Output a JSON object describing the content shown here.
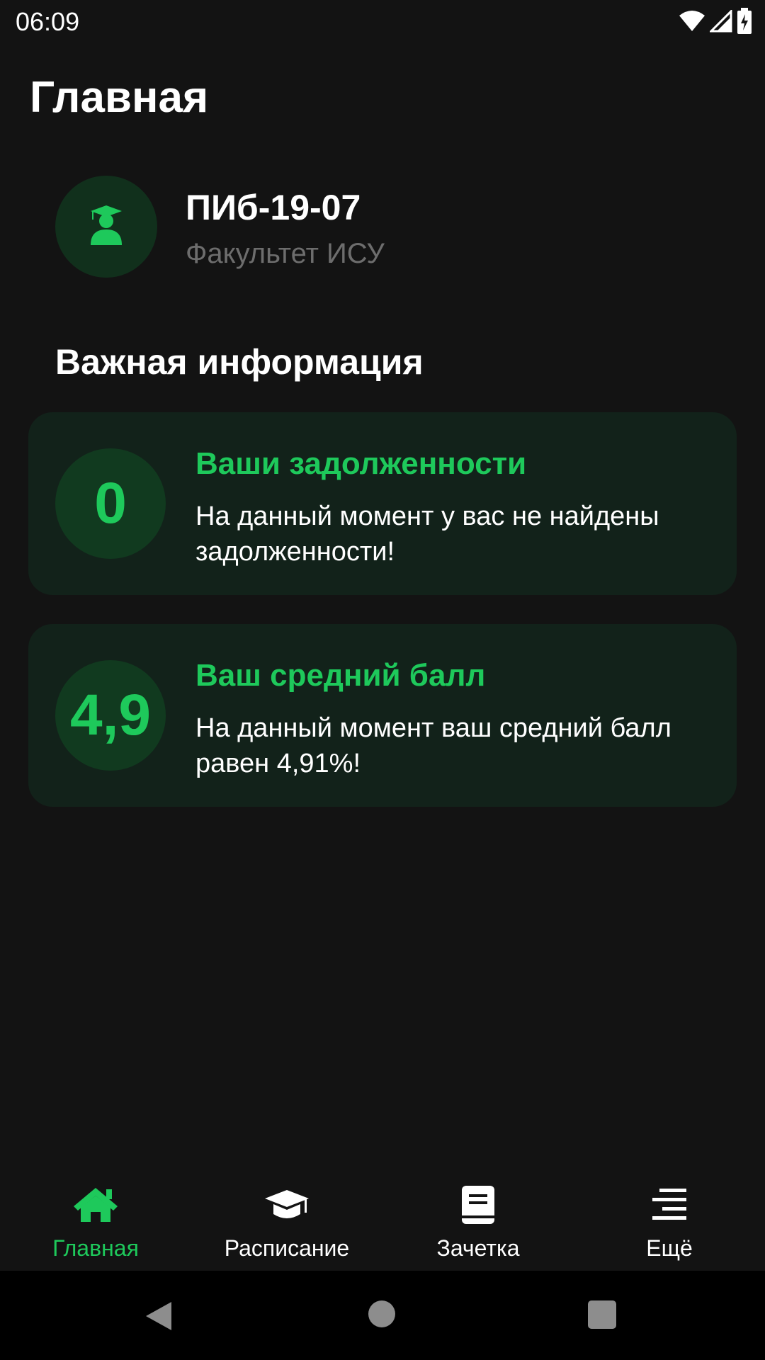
{
  "status_bar": {
    "time": "06:09",
    "icons": [
      "wifi-icon",
      "signal-icon",
      "battery-charging-icon"
    ]
  },
  "header": {
    "title": "Главная"
  },
  "profile": {
    "icon": "graduate-icon",
    "group": "ПИб-19-07",
    "faculty": "Факультет ИСУ"
  },
  "important": {
    "section_title": "Важная информация",
    "cards": [
      {
        "badge": "0",
        "title": "Ваши задолженности",
        "text": "На данный момент у вас не найдены задолженности!"
      },
      {
        "badge": "4,9",
        "title": "Ваш средний балл",
        "text": "На данный момент ваш средний балл равен 4,91%!"
      }
    ]
  },
  "bottom_nav": {
    "items": [
      {
        "label": "Главная",
        "icon": "home-icon",
        "active": true
      },
      {
        "label": "Расписание",
        "icon": "graduation-cap-icon",
        "active": false
      },
      {
        "label": "Зачетка",
        "icon": "book-icon",
        "active": false
      },
      {
        "label": "Ещё",
        "icon": "menu-icon",
        "active": false
      }
    ]
  },
  "colors": {
    "background": "#131313",
    "accent": "#1ec95b",
    "card_background": "#12221a",
    "badge_background": "#113a1f",
    "avatar_background": "#11301c",
    "muted_text": "#6d6d6d"
  }
}
